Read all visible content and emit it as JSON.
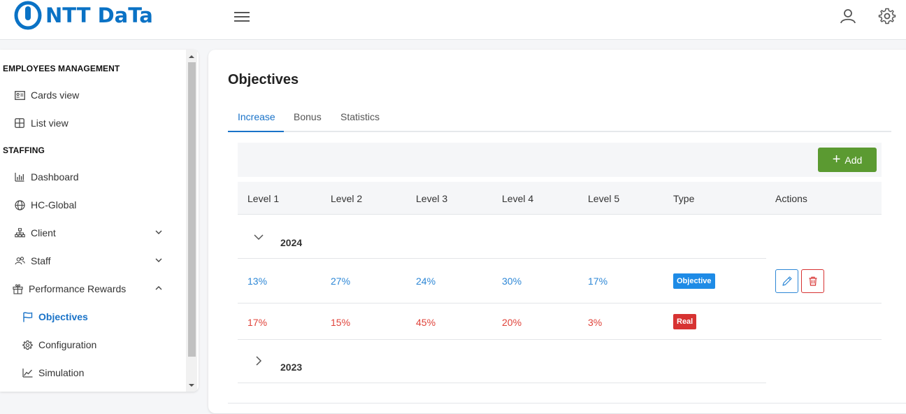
{
  "header": {
    "logo_text": "NTT DaTa",
    "icons": {
      "menu": "hamburger-menu-icon",
      "user": "user-icon",
      "settings": "gear-icon"
    }
  },
  "sidebar": {
    "sections": [
      {
        "title": "EMPLOYEES MANAGEMENT"
      },
      {
        "title": "STAFFING"
      }
    ],
    "items": [
      {
        "label": "Cards view",
        "icon": "id-card-icon"
      },
      {
        "label": "List view",
        "icon": "table-icon"
      },
      {
        "label": "Dashboard",
        "icon": "bar-chart-icon"
      },
      {
        "label": "HC-Global",
        "icon": "globe-icon"
      },
      {
        "label": "Client",
        "icon": "org-chart-icon"
      },
      {
        "label": "Staff",
        "icon": "users-icon"
      },
      {
        "label": "Performance Rewards",
        "icon": "gift-icon"
      },
      {
        "label": "Objectives",
        "icon": "flag-icon"
      },
      {
        "label": "Configuration",
        "icon": "gear-icon"
      },
      {
        "label": "Simulation",
        "icon": "line-chart-icon"
      }
    ]
  },
  "main": {
    "title": "Objectives",
    "tabs": [
      "Increase",
      "Bonus",
      "Statistics"
    ],
    "active_tab": "Increase",
    "add_label": "Add",
    "columns": [
      "Level 1",
      "Level 2",
      "Level 3",
      "Level 4",
      "Level 5",
      "Type",
      "Actions"
    ],
    "groups": [
      {
        "year": "2024",
        "expanded": true,
        "rows": [
          {
            "levels": [
              "13%",
              "27%",
              "24%",
              "30%",
              "17%"
            ],
            "type": "Objective"
          },
          {
            "levels": [
              "17%",
              "15%",
              "45%",
              "20%",
              "3%"
            ],
            "type": "Real"
          }
        ]
      },
      {
        "year": "2023",
        "expanded": false,
        "rows": []
      }
    ]
  },
  "colors": {
    "brand": "#0a72c5",
    "accent": "#1a73c8",
    "add_button": "#5b9a31",
    "objective": "#1e8be6",
    "real": "#d73332"
  }
}
